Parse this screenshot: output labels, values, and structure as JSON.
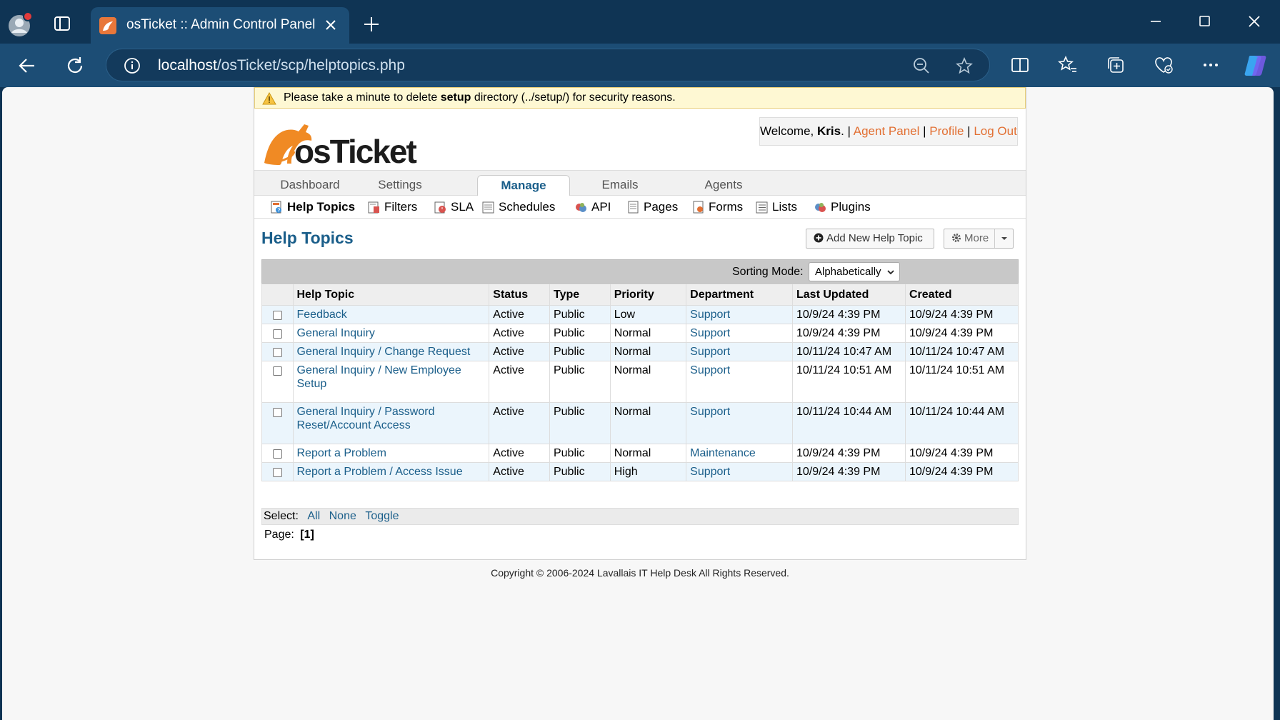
{
  "browser": {
    "tab_title": "osTicket :: Admin Control Panel",
    "url_host": "localhost",
    "url_path": "/osTicket/scp/helptopics.php"
  },
  "banner": {
    "text_pre": "Please take a minute to delete ",
    "text_bold": "setup",
    "text_post": " directory (../setup/) for security reasons."
  },
  "logo_text": "osTicket",
  "user": {
    "welcome": "Welcome, ",
    "name": "Kris",
    "dot": ".",
    "sep": " | ",
    "agent_panel": "Agent Panel",
    "profile": "Profile",
    "logout": "Log Out"
  },
  "main_nav": [
    "Dashboard",
    "Settings",
    "Manage",
    "Emails",
    "Agents"
  ],
  "sub_nav": [
    "Help Topics",
    "Filters",
    "SLA",
    "Schedules",
    "API",
    "Pages",
    "Forms",
    "Lists",
    "Plugins"
  ],
  "page": {
    "title": "Help Topics",
    "add_button": "Add New Help Topic",
    "more_button": "More",
    "sorting_label": "Sorting Mode:",
    "sorting_value": "Alphabetically"
  },
  "table": {
    "headers": [
      "Help Topic",
      "Status",
      "Type",
      "Priority",
      "Department",
      "Last Updated",
      "Created"
    ],
    "rows": [
      {
        "topic": "Feedback",
        "status": "Active",
        "type": "Public",
        "priority": "Low",
        "department": "Support",
        "updated": "10/9/24 4:39 PM",
        "created": "10/9/24 4:39 PM"
      },
      {
        "topic": "General Inquiry",
        "status": "Active",
        "type": "Public",
        "priority": "Normal",
        "department": "Support",
        "updated": "10/9/24 4:39 PM",
        "created": "10/9/24 4:39 PM"
      },
      {
        "topic": "General Inquiry / Change Request",
        "status": "Active",
        "type": "Public",
        "priority": "Normal",
        "department": "Support",
        "updated": "10/11/24 10:47 AM",
        "created": "10/11/24 10:47 AM"
      },
      {
        "topic": "General Inquiry / New Employee Setup",
        "status": "Active",
        "type": "Public",
        "priority": "Normal",
        "department": "Support",
        "updated": "10/11/24 10:51 AM",
        "created": "10/11/24 10:51 AM"
      },
      {
        "topic": "General Inquiry / Password Reset/Account Access",
        "status": "Active",
        "type": "Public",
        "priority": "Normal",
        "department": "Support",
        "updated": "10/11/24 10:44 AM",
        "created": "10/11/24 10:44 AM"
      },
      {
        "topic": "Report a Problem",
        "status": "Active",
        "type": "Public",
        "priority": "Normal",
        "department": "Maintenance",
        "updated": "10/9/24 4:39 PM",
        "created": "10/9/24 4:39 PM"
      },
      {
        "topic": "Report a Problem / Access Issue",
        "status": "Active",
        "type": "Public",
        "priority": "High",
        "department": "Support",
        "updated": "10/9/24 4:39 PM",
        "created": "10/9/24 4:39 PM"
      }
    ]
  },
  "select": {
    "label": "Select:",
    "all": "All",
    "none": "None",
    "toggle": "Toggle"
  },
  "pager": {
    "label": "Page:",
    "current": "[1]"
  },
  "footer": "Copyright © 2006-2024 Lavallais IT Help Desk All Rights Reserved.",
  "colors": {
    "accent": "#1a5e8a",
    "link_orange": "#e26f32",
    "browser_bg": "#0f3454",
    "banner_bg": "#fef8d3"
  }
}
